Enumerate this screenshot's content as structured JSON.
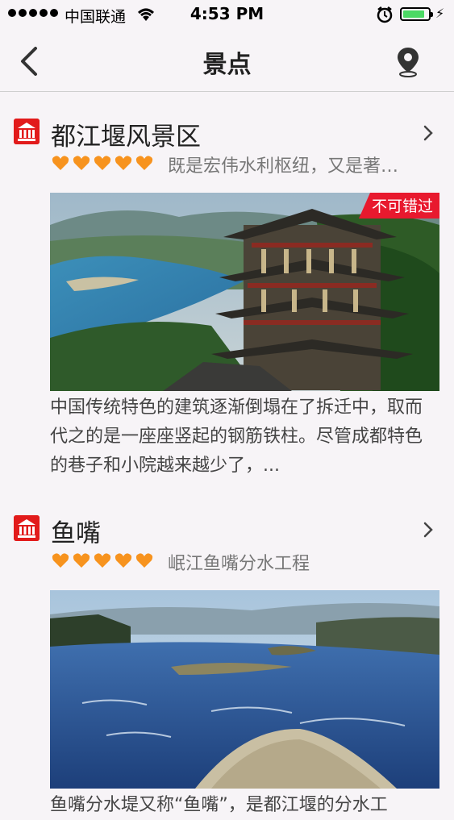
{
  "status_bar": {
    "carrier": "中国联通",
    "time": "4:53 PM",
    "battery_level": 0.85,
    "icons": [
      "signal-dots-icon",
      "wifi-icon",
      "alarm-icon",
      "battery-icon",
      "charging-icon"
    ]
  },
  "nav": {
    "title": "景点",
    "back_icon": "back-chevron-icon",
    "map_icon": "location-pin-icon"
  },
  "spots": [
    {
      "name": "都江堰风景区",
      "rating": 5,
      "tagline": "既是宏伟水利枢纽，又是著…",
      "badge": "不可错过",
      "description": "中国传统特色的建筑逐渐倒塌在了拆迁中，取而代之的是一座座竖起的钢筋铁柱。尽管成都特色的巷子和小院越来越少了，..."
    },
    {
      "name": "鱼嘴",
      "rating": 5,
      "tagline": "岷江鱼嘴分水工程",
      "description": "鱼嘴分水堤又称“鱼嘴”，是都江堰的分水工"
    }
  ],
  "colors": {
    "accent_red": "#e21b1b",
    "star_orange": "#f7931e",
    "badge_red": "#e8192e",
    "background": "#f7f4f7"
  }
}
